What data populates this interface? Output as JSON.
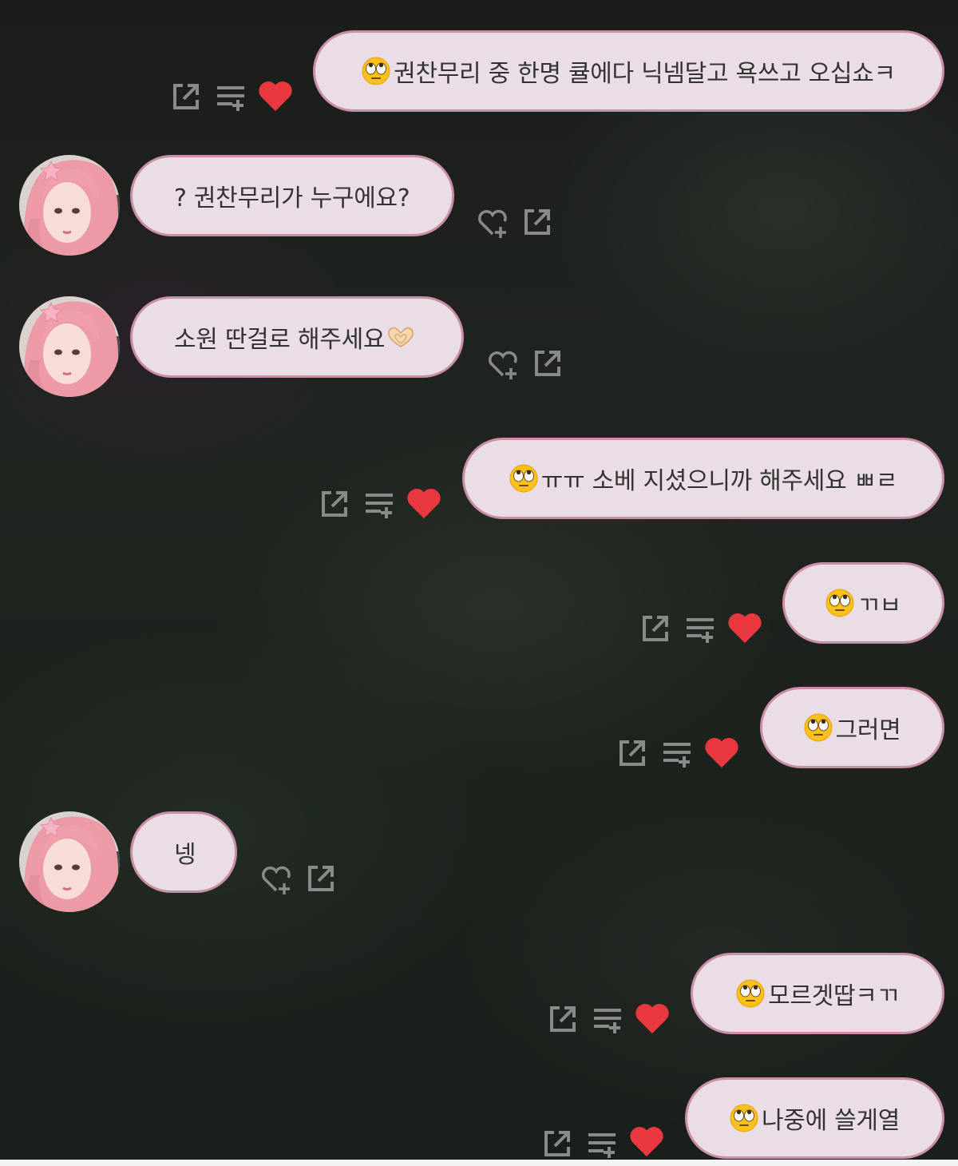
{
  "colors": {
    "bubble_bg": "#eadde5",
    "bubble_border": "#c98fa6",
    "liked_heart": "#e9383f",
    "action_icon": "#8a8a8a"
  },
  "icons": [
    "share-icon",
    "add-to-queue-icon",
    "heart-filled-icon",
    "heart-plus-icon",
    "rolling-eyes-emoji-icon",
    "heart-hands-emoji-icon",
    "avatar"
  ],
  "messages": [
    {
      "sender": "me",
      "emoji": "rolling-eyes",
      "text": "권찬무리 중 한명 큘에다 닉넴달고 욕쓰고 오십쇼ㅋ",
      "liked": true
    },
    {
      "sender": "other",
      "text": "? 권찬무리가 누구에요?"
    },
    {
      "sender": "other",
      "text": "소원 딴걸로 해주세요",
      "trailing_emoji": "heart-hands"
    },
    {
      "sender": "me",
      "emoji": "rolling-eyes",
      "text": "ㅠㅠ 소베 지셨으니까 해주세요 ㅃㄹ",
      "liked": true
    },
    {
      "sender": "me",
      "emoji": "rolling-eyes",
      "text": "ㄲㅂ",
      "liked": true
    },
    {
      "sender": "me",
      "emoji": "rolling-eyes",
      "text": "그러면",
      "liked": true
    },
    {
      "sender": "other",
      "text": "넹"
    },
    {
      "sender": "me",
      "emoji": "rolling-eyes",
      "text": "모르겟땁ㅋㄲ",
      "liked": true
    },
    {
      "sender": "me",
      "emoji": "rolling-eyes",
      "text": "나중에 쓸게열",
      "liked": true
    }
  ]
}
